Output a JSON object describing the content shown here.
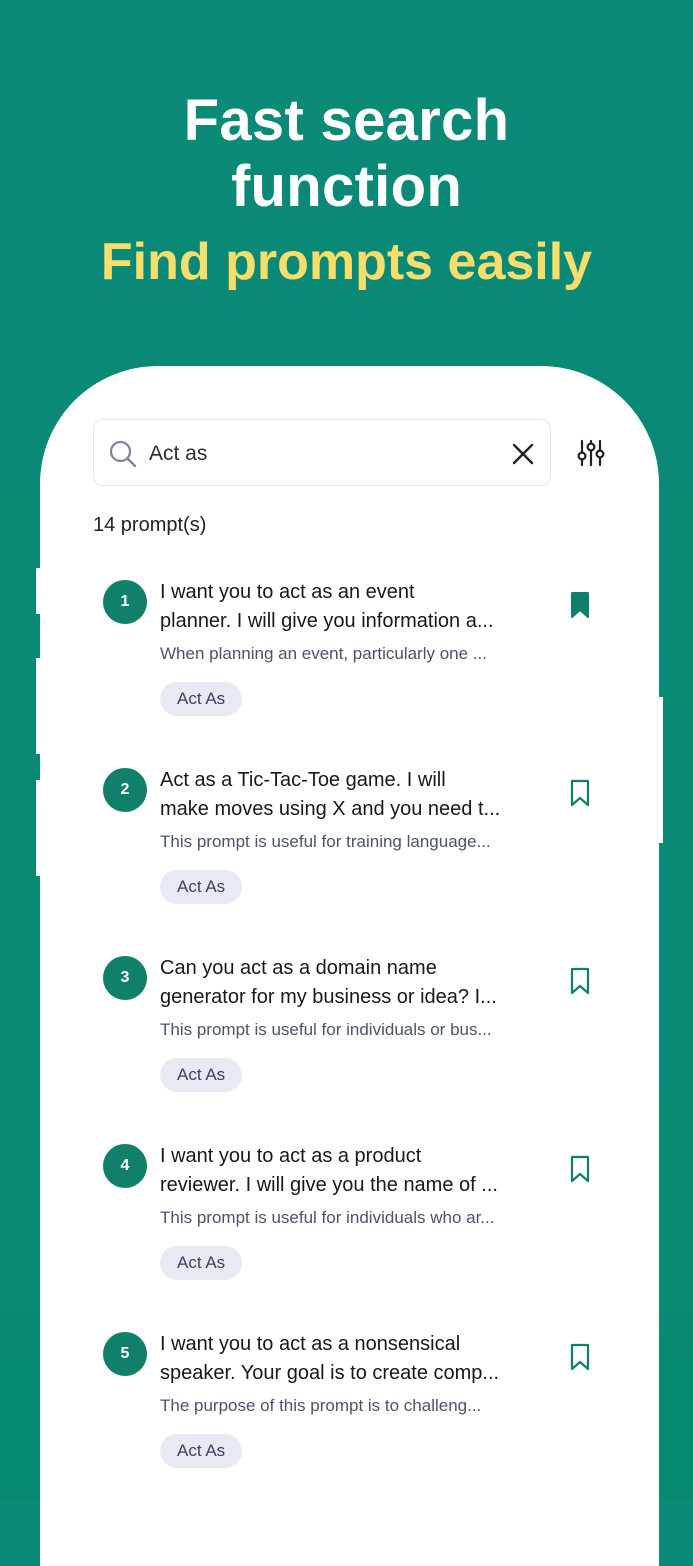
{
  "hero": {
    "title_line1": "Fast search",
    "title_line2": "function",
    "subtitle": "Find prompts easily"
  },
  "search": {
    "query": "Act as"
  },
  "results": {
    "count_label": "14 prompt(s)"
  },
  "prompts": [
    {
      "number": "1",
      "title_line1": "I want you to act as an event",
      "title_line2": "planner. I will give you information a...",
      "description": "When planning an event, particularly one ...",
      "tag": "Act As",
      "bookmarked": true
    },
    {
      "number": "2",
      "title_line1": "Act as a Tic-Tac-Toe game. I will",
      "title_line2": "make moves using X and you need t...",
      "description": "This prompt is useful for training language...",
      "tag": "Act As",
      "bookmarked": false
    },
    {
      "number": "3",
      "title_line1": "Can you act as a domain name",
      "title_line2": "generator for my business or idea? I...",
      "description": "This prompt is useful for individuals or bus...",
      "tag": "Act As",
      "bookmarked": false
    },
    {
      "number": "4",
      "title_line1": "I want you to act as a product",
      "title_line2": "reviewer. I will give you the name of ...",
      "description": "This prompt is useful for individuals who ar...",
      "tag": "Act As",
      "bookmarked": false
    },
    {
      "number": "5",
      "title_line1": "I want you to act as a nonsensical",
      "title_line2": "speaker. Your goal is to create comp...",
      "description": "The purpose of this prompt is to challeng...",
      "tag": "Act As",
      "bookmarked": false
    }
  ],
  "icons": {
    "search": "search-icon",
    "clear": "close-icon",
    "filter": "filter-sliders-icon",
    "bookmark_filled": "bookmark-filled-icon",
    "bookmark_outline": "bookmark-outline-icon"
  },
  "colors": {
    "background": "#0b8a77",
    "accent": "#11806b",
    "subtitle_yellow": "#f6dd6c",
    "tag_bg": "#e8eaf3"
  }
}
